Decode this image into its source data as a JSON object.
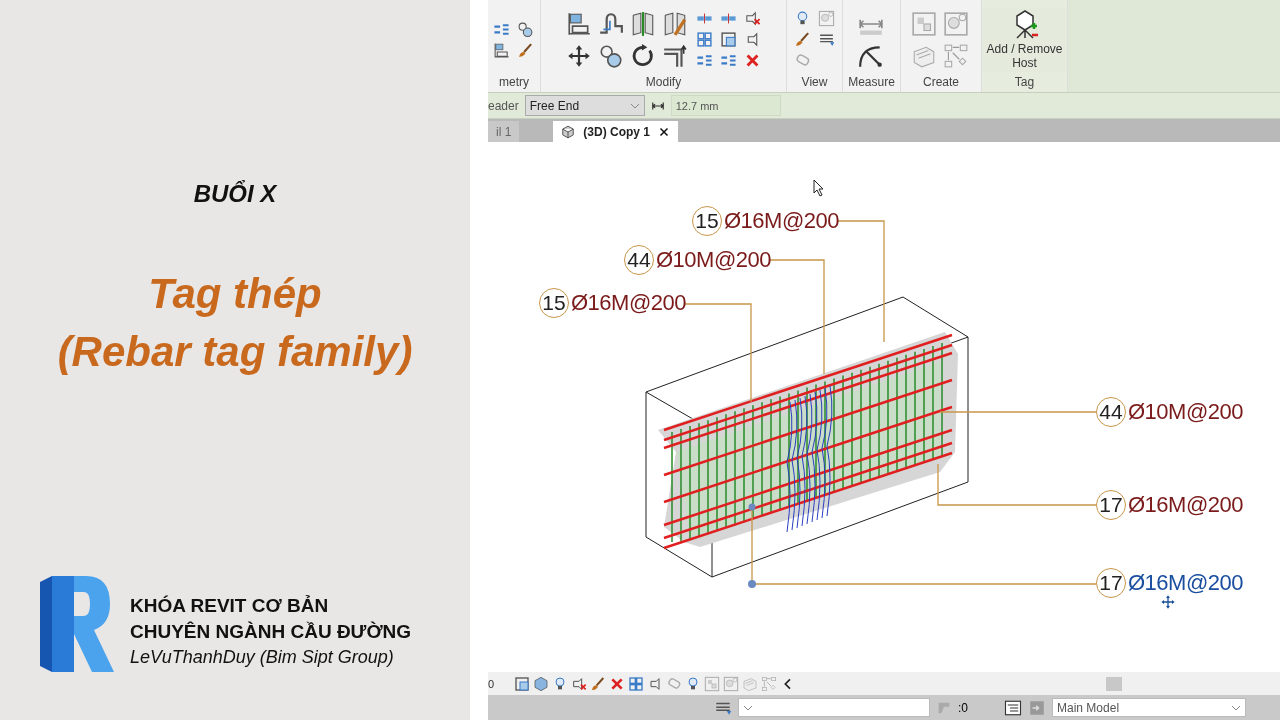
{
  "title_panel": {
    "session": "BUỔI X",
    "title": "Tag thép",
    "subtitle": "(Rebar tag family)",
    "course_line_1": "KHÓA REVIT CƠ BẢN",
    "course_line_2": "CHUYÊN NGÀNH CẦU ĐƯỜNG",
    "author": "LeVuThanhDuy (Bim Sipt Group)"
  },
  "ribbon": {
    "panels": [
      {
        "label": "metry"
      },
      {
        "label": "Modify"
      },
      {
        "label": "View"
      },
      {
        "label": "Measure"
      },
      {
        "label": "Create"
      },
      {
        "label": "Tag"
      }
    ],
    "host_button": "Add / Remove Host"
  },
  "options_bar": {
    "label": "eader",
    "leader_end": "Free End",
    "length": "12.7 mm"
  },
  "view_tabs": [
    {
      "label": "il 1",
      "selected": false
    },
    {
      "label": "(3D) Copy 1",
      "selected": true
    }
  ],
  "tags": [
    {
      "count": "15",
      "mark": "Ø16M@200",
      "selected": false
    },
    {
      "count": "44",
      "mark": "Ø10M@200",
      "selected": false
    },
    {
      "count": "15",
      "mark": "Ø16M@200",
      "selected": false
    },
    {
      "count": "44",
      "mark": "Ø10M@200",
      "selected": false
    },
    {
      "count": "17",
      "mark": "Ø16M@200",
      "selected": false
    },
    {
      "count": "17",
      "mark": "Ø16M@200",
      "selected": true
    }
  ],
  "view_control_bar": {
    "scale": "0"
  },
  "status_bar": {
    "count": ":0",
    "model": "Main Model"
  }
}
